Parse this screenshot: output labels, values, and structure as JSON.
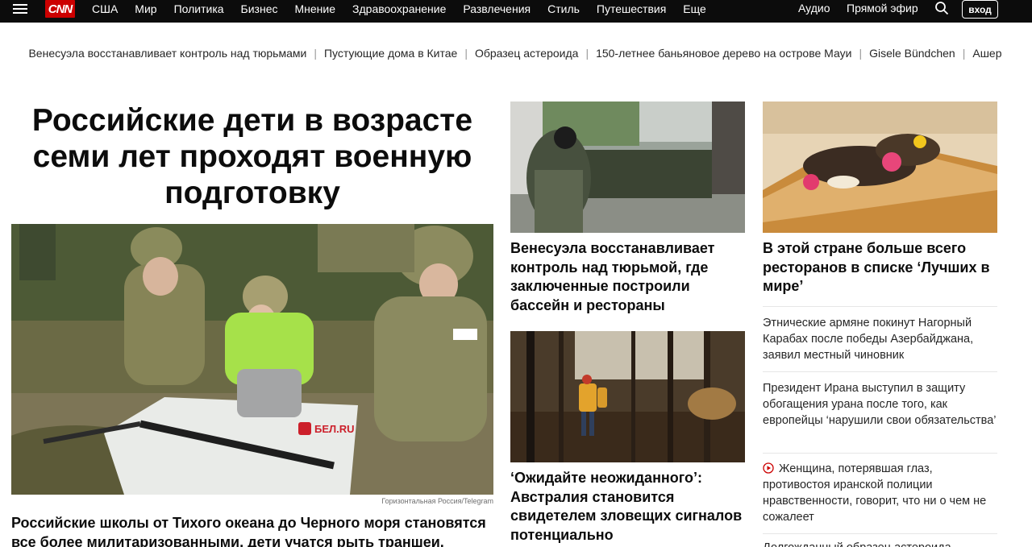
{
  "header": {
    "logo_text": "CNN",
    "nav": [
      "США",
      "Мир",
      "Политика",
      "Бизнес",
      "Мнение",
      "Здравоохранение",
      "Развлечения",
      "Стиль",
      "Путешествия",
      "Еще"
    ],
    "audio": "Аудио",
    "live": "Прямой эфир",
    "login": "вход"
  },
  "trending": [
    "Венесуэла восстанавливает контроль над тюрьмами",
    "Пустующие дома в Китае",
    "Образец астероида",
    "150-летнее баньяновое дерево на острове Мауи",
    "Gisele Bündchen",
    "Ашер"
  ],
  "lead": {
    "headline": "Российские дети в возрасте семи лет проходят военную подготовку",
    "watermark": "БЕЛ.RU",
    "credit": "Горизонтальная Россия/Telegram",
    "subhead": "Российские школы от Тихого океана до Черного моря становятся все более милитаризованными, дети учатся рыть траншеи, бросать"
  },
  "middle": {
    "story1": "Венесуэла восстанавливает контроль над тюрьмой, где заключенные построили бассейн и рестораны",
    "story2": "‘Ожидайте неожиданного’: Австралия становится свидетелем зловещих сигналов потенциально разрушительного"
  },
  "right": {
    "feature": "В этой стране больше всего ресторанов в списке ‘Лучших в мире’",
    "items": [
      "Этнические армяне покинут Нагорный Карабах после победы Азербайджана, заявил местный чиновник",
      "Президент Ирана выступил в защиту обогащения урана после того, как европейцы ‘нарушили свои обязательства’",
      "Женщина, потерявшая глаз, противостоя иранской полиции нравственности, говорит, что ни о чем не сожалеет",
      "Долгожданный образец астероида"
    ]
  },
  "colors": {
    "brand": "#cc0000",
    "nav_bg": "#0c0c0c"
  }
}
